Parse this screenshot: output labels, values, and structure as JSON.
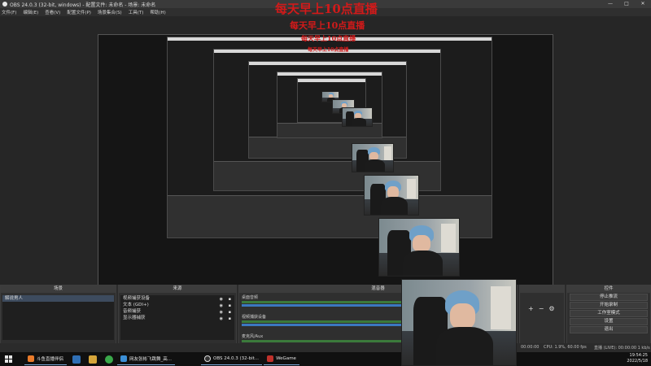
{
  "window": {
    "title": "OBS 24.0.3 (32-bit, windows) - 配置文件: 未命名 - 场景: 未命名",
    "controls": [
      "—",
      "□",
      "✕"
    ]
  },
  "menu": [
    "文件(F)",
    "编辑(E)",
    "查看(V)",
    "配置文件(P)",
    "场景集合(S)",
    "工具(T)",
    "帮助(H)"
  ],
  "overlay": {
    "line": "每天早上10点直播"
  },
  "scenes": {
    "header": "场景",
    "items": [
      "解说男人"
    ]
  },
  "sources": {
    "header": "来源",
    "items": [
      "视频捕获设备",
      "文本 (GDI+)",
      "音频捕获",
      "显示器捕获"
    ]
  },
  "mixer": {
    "header": "混音器",
    "tracks": [
      "桌面音频",
      "视频捕获设备",
      "麦克风/Aux"
    ]
  },
  "controls": {
    "header": "控件",
    "buttons": [
      "停止推流",
      "开始录制",
      "工作室模式",
      "设置",
      "退出"
    ]
  },
  "status": {
    "time": "00:00:00",
    "cpu": "CPU: 1.9%, 60.00 fps",
    "live": "直播 (LIVE): 00:00:00 1 kb/s"
  },
  "taskbar": {
    "apps": [
      {
        "label": "斗鱼直播伴侣",
        "color": "#e87a2a"
      },
      {
        "label": "网友张彬飞跳舞_高...",
        "color": "#3b8fd6"
      },
      {
        "label": "OBS 24.0.3 (32-bit...",
        "color": "#333333"
      },
      {
        "label": "WeGame",
        "color": "#c0312b"
      }
    ],
    "time": "19:54:25",
    "date": "2022/5/18"
  }
}
